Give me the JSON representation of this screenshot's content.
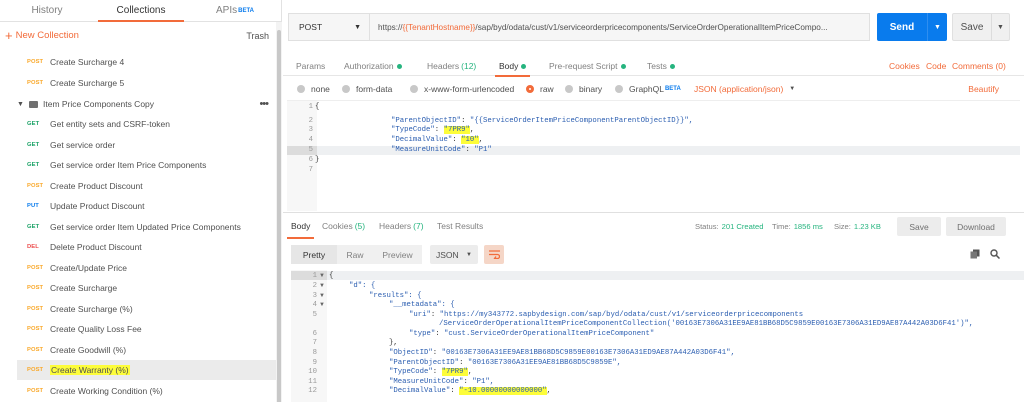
{
  "sidebar": {
    "tabs": [
      {
        "label": "History"
      },
      {
        "label": "Collections"
      },
      {
        "label": "APIs"
      }
    ],
    "apis_badge": "BETA",
    "new_collection": "New Collection",
    "trash": "Trash",
    "folder_name": "Item Price Components Copy",
    "items": [
      {
        "method": "POST",
        "name": "Create Surcharge 4"
      },
      {
        "method": "POST",
        "name": "Create Surcharge 5"
      },
      {
        "method": "GET",
        "name": "Get entity sets and CSRF-token"
      },
      {
        "method": "GET",
        "name": "Get service order"
      },
      {
        "method": "GET",
        "name": "Get service order Item Price Components"
      },
      {
        "method": "POST",
        "name": "Create Product Discount"
      },
      {
        "method": "PUT",
        "name": "Update Product Discount"
      },
      {
        "method": "GET",
        "name": "Get service order Item Updated Price Components"
      },
      {
        "method": "DEL",
        "name": "Delete Product Discount"
      },
      {
        "method": "POST",
        "name": "Create/Update Price"
      },
      {
        "method": "POST",
        "name": "Create Surcharge"
      },
      {
        "method": "POST",
        "name": "Create Surcharge (%)"
      },
      {
        "method": "POST",
        "name": "Create Quality Loss Fee"
      },
      {
        "method": "POST",
        "name": "Create Goodwill (%)"
      },
      {
        "method": "POST",
        "name": "Create Warranty (%)"
      },
      {
        "method": "POST",
        "name": "Create Working Condition (%)"
      }
    ]
  },
  "request": {
    "method": "POST",
    "url_prefix": "https://",
    "url_var": "{{TenantHostname}}",
    "url_suffix": "/sap/byd/odata/cust/v1/serviceorderpricecomponents/ServiceOrderOperationalItemPriceCompo...",
    "send": "Send",
    "save": "Save",
    "tabs": {
      "params": "Params",
      "authorization": "Authorization",
      "headers": "Headers",
      "headers_count": "(12)",
      "body": "Body",
      "prerequest": "Pre-request Script",
      "tests": "Tests"
    },
    "cookies": "Cookies",
    "code": "Code",
    "comments": "Comments (0)",
    "body_types": [
      "none",
      "form-data",
      "x-www-form-urlencoded",
      "raw",
      "binary",
      "GraphQL"
    ],
    "graphql_badge": "BETA",
    "content_type": "JSON (application/json)",
    "beautify": "Beautify",
    "lines": [
      "1",
      "2",
      "3",
      "4",
      "5",
      "6",
      "7"
    ]
  },
  "request_body": {
    "l1": "{",
    "l2k": "\"ParentObjectID\"",
    "l2v": "\"{{ServiceOrderItemPriceComponentParentObjectID}}\",",
    "l3k": "\"TypeCode\"",
    "l3v": "\"7PR9\"",
    "l4k": "\"DecimalValue\"",
    "l4v": "\"10\"",
    "l5k": "\"MeasureUnitCode\"",
    "l5v": "\"P1\"",
    "l6": "}"
  },
  "response": {
    "tabs": {
      "body": "Body",
      "cookies": "Cookies",
      "cookies_count": "(5)",
      "headers": "Headers",
      "headers_count": "(7)",
      "tests": "Test Results"
    },
    "status_label": "Status:",
    "status": "201 Created",
    "time_label": "Time:",
    "time": "1856 ms",
    "size_label": "Size:",
    "size": "1.23 KB",
    "save": "Save",
    "download": "Download",
    "views": [
      "Pretty",
      "Raw",
      "Preview"
    ],
    "format": "JSON",
    "lines": [
      "1",
      "2",
      "3",
      "4",
      "5",
      "",
      "6",
      "7",
      "8",
      "9",
      "10",
      "11",
      "12"
    ],
    "code": {
      "c1": "{",
      "c2": "\"d\": {",
      "c3": "\"results\": {",
      "c4": "\"__metadata\": {",
      "c5k": "\"uri\"",
      "c5v": "\"https://my343772.sapbydesign.com/sap/byd/odata/cust/v1/serviceorderpricecomponents",
      "c5b": "/ServiceOrderOperationalItemPriceComponentCollection('00163E7306A31EE9AE81BB68D5C9859E00163E7306A31ED9AE87A442A03D6F41')\",",
      "c6k": "\"type\"",
      "c6v": "\"cust.ServiceOrderOperationalItemPriceComponent\"",
      "c7": "},",
      "c8k": "\"ObjectID\"",
      "c8v": "\"00163E7306A31EE9AE81BB68D5C9859E00163E7306A31ED9AE87A442A03D6F41\",",
      "c9k": "\"ParentObjectID\"",
      "c9v": "\"00163E7306A31EE9AE81BB68D5C9859E\",",
      "c10k": "\"TypeCode\"",
      "c10v": "\"7PR9\"",
      "c11k": "\"MeasureUnitCode\"",
      "c11v": "\"P1\",",
      "c12k": "\"DecimalValue\"",
      "c12v": "\"-10.00000000000000\""
    }
  }
}
